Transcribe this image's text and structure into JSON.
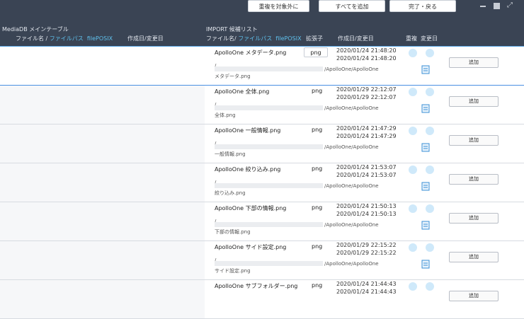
{
  "toolbar": {
    "exclude_dup_label": "重複を対象外に",
    "add_all_label": "すべてを追加",
    "done_back_label": "完了・戻る"
  },
  "left_panel": {
    "title": "MediaDB メインテーブル",
    "col_filename": "ファイル名 / ",
    "col_filepath": "ファイルパス",
    "col_fileposix": "filePOSIX",
    "col_dates": "作成日/変更日"
  },
  "right_panel": {
    "title": "IMPORT 候補リスト",
    "col_filename": "ファイル名/ ",
    "col_filepath": "ファイルパス",
    "col_fileposix": "filePOSIX",
    "col_ext": "拡張子",
    "col_dates": "作成日/変更日",
    "col_dup": "重複",
    "col_changed": "変更日"
  },
  "colors": {
    "topbar": "#3a4454",
    "accent": "#5fc0ec",
    "dot": "#cfe9fa",
    "edit_icon": "#3a8fd6"
  },
  "icons": {
    "edit": "edit-document-icon",
    "dup": "dot-indicator",
    "minimize": "minimize-icon",
    "maximize": "maximize-icon",
    "fullscreen": "fullscreen-icon"
  },
  "rows": [
    {
      "name": "ApolloOne  メタデータ.png",
      "ext": "png",
      "created": "2020/01/24 21:48:20",
      "modified": "2020/01/24 21:48:20",
      "path_slash": "/",
      "path_tail": "/ApolloOne/ApolloOne",
      "path_file": "メタデータ.png",
      "add_label": "追加"
    },
    {
      "name": "ApolloOne 全体.png",
      "ext": "png",
      "created": "2020/01/29 22:12:07",
      "modified": "2020/01/29 22:12:07",
      "path_slash": "/",
      "path_tail": "/ApolloOne/ApolloOne",
      "path_file": "全体.png",
      "add_label": "追加"
    },
    {
      "name": "ApolloOne 一般情報.png",
      "ext": "png",
      "created": "2020/01/24 21:47:29",
      "modified": "2020/01/24 21:47:29",
      "path_slash": "/",
      "path_tail": "/ApolloOne/ApolloOne",
      "path_file": "一般情報.png",
      "add_label": "追加"
    },
    {
      "name": "ApolloOne 絞り込み.png",
      "ext": "png",
      "created": "2020/01/24 21:53:07",
      "modified": "2020/01/24 21:53:07",
      "path_slash": "/",
      "path_tail": "/ApolloOne/ApolloOne",
      "path_file": "絞り込み.png",
      "add_label": "追加"
    },
    {
      "name": "ApolloOne 下部の情報.png",
      "ext": "png",
      "created": "2020/01/24 21:50:13",
      "modified": "2020/01/24 21:50:13",
      "path_slash": "/",
      "path_tail": "/ApolloOne/ApolloOne",
      "path_file": "下部の情報.png",
      "add_label": "追加"
    },
    {
      "name": "ApolloOne サイド設定.png",
      "ext": "png",
      "created": "2020/01/29 22:15:22",
      "modified": "2020/01/29 22:15:22",
      "path_slash": "/",
      "path_tail": "/ApolloOne/ApolloOne",
      "path_file": "サイド設定.png",
      "add_label": "追加"
    },
    {
      "name": "ApolloOne サブフォルダー.png",
      "ext": "png",
      "created": "2020/01/24 21:44:43",
      "modified": "2020/01/24 21:44:43",
      "path_slash": "/",
      "path_tail": "/ApolloOne/ApolloOne",
      "path_file": "",
      "add_label": "追加"
    }
  ]
}
